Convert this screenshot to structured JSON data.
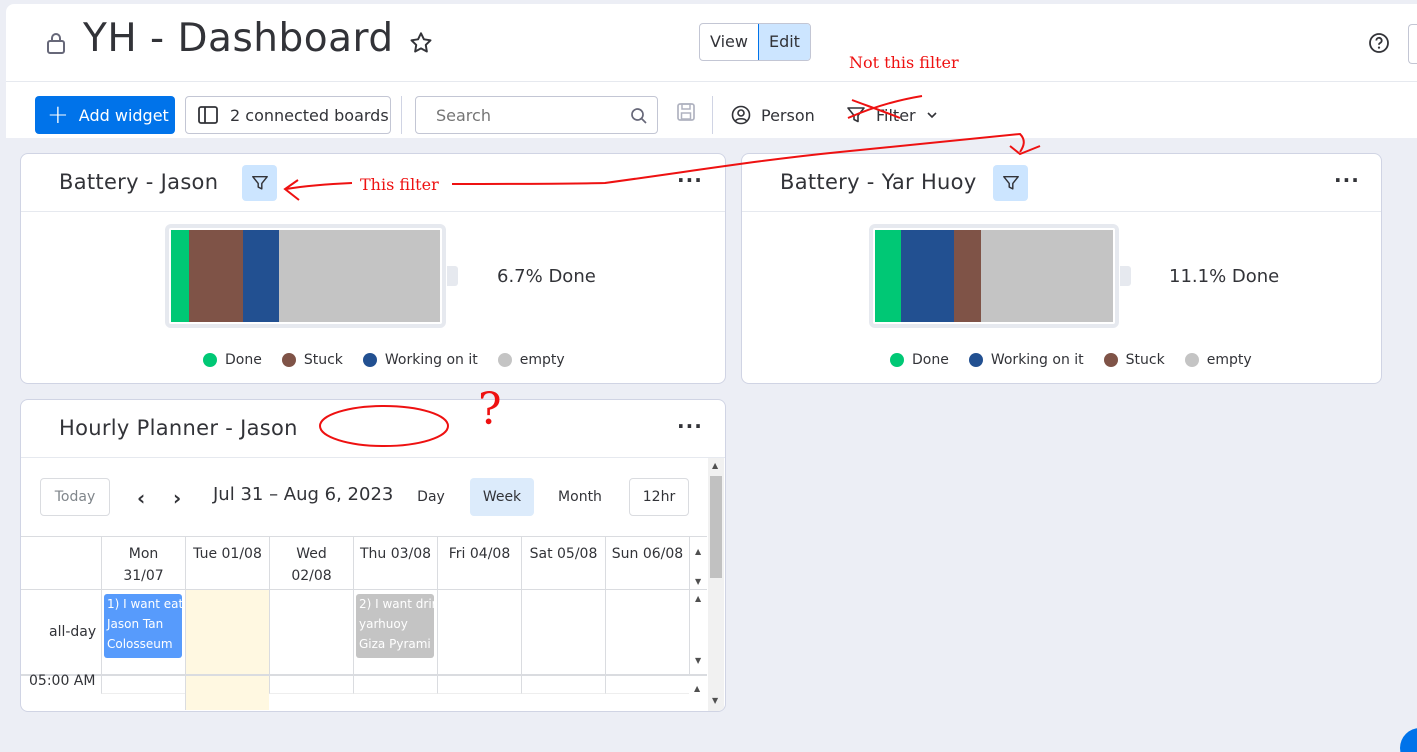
{
  "header": {
    "title": "YH - Dashboard",
    "view_label": "View",
    "edit_label": "Edit"
  },
  "toolbar": {
    "add_widget_label": "Add widget",
    "connected_boards_label": "2 connected boards",
    "search_placeholder": "Search",
    "person_label": "Person",
    "filter_label": "Filter"
  },
  "widgets": {
    "battery_jason": {
      "title": "Battery - Jason",
      "done_text": "6.7% Done",
      "segments": [
        {
          "status": "Done",
          "fraction": 0.067,
          "color": "#00c875"
        },
        {
          "status": "Stuck",
          "fraction": 0.2,
          "color": "#7f5347"
        },
        {
          "status": "Working on it",
          "fraction": 0.133,
          "color": "#225091"
        },
        {
          "status": "empty",
          "fraction": 0.6,
          "color": "#c4c4c4"
        }
      ],
      "legend": [
        {
          "label": "Done",
          "color": "#00c875"
        },
        {
          "label": "Stuck",
          "color": "#7f5347"
        },
        {
          "label": "Working on it",
          "color": "#225091"
        },
        {
          "label": "empty",
          "color": "#c4c4c4"
        }
      ]
    },
    "battery_yar": {
      "title": "Battery - Yar Huoy",
      "done_text": "11.1% Done",
      "segments": [
        {
          "status": "Done",
          "fraction": 0.111,
          "color": "#00c875"
        },
        {
          "status": "Working on it",
          "fraction": 0.222,
          "color": "#225091"
        },
        {
          "status": "Stuck",
          "fraction": 0.111,
          "color": "#7f5347"
        },
        {
          "status": "empty",
          "fraction": 0.556,
          "color": "#c4c4c4"
        }
      ],
      "legend": [
        {
          "label": "Done",
          "color": "#00c875"
        },
        {
          "label": "Working on it",
          "color": "#225091"
        },
        {
          "label": "Stuck",
          "color": "#7f5347"
        },
        {
          "label": "empty",
          "color": "#c4c4c4"
        }
      ]
    },
    "planner": {
      "title": "Hourly Planner - Jason",
      "today_label": "Today",
      "range": "Jul 31 – Aug 6, 2023",
      "modes": [
        "Day",
        "Week",
        "Month"
      ],
      "active_mode": "Week",
      "hour_format": "12hr",
      "columns": [
        "Mon\n31/07",
        "Tue 01/08",
        "Wed\n02/08",
        "Thu 03/08",
        "Fri 04/08",
        "Sat 05/08",
        "Sun 06/08"
      ],
      "allday_label": "all-day",
      "time_label": "05:00 AM",
      "events": [
        {
          "lines": [
            "1) I want eat",
            "Jason Tan",
            "Colosseum"
          ],
          "color": "#579bfc"
        },
        {
          "lines": [
            "2) I want drir",
            "yarhuoy",
            "Giza Pyrami"
          ],
          "color": "#c4c4c4"
        }
      ]
    }
  },
  "annotations": {
    "not_this_filter": "Not  this  filter",
    "this_filter": "This  filter",
    "question": "?"
  },
  "colors": {
    "accent": "#0073ea",
    "annotation": "#e11111",
    "today_column": "#fff8e1"
  }
}
